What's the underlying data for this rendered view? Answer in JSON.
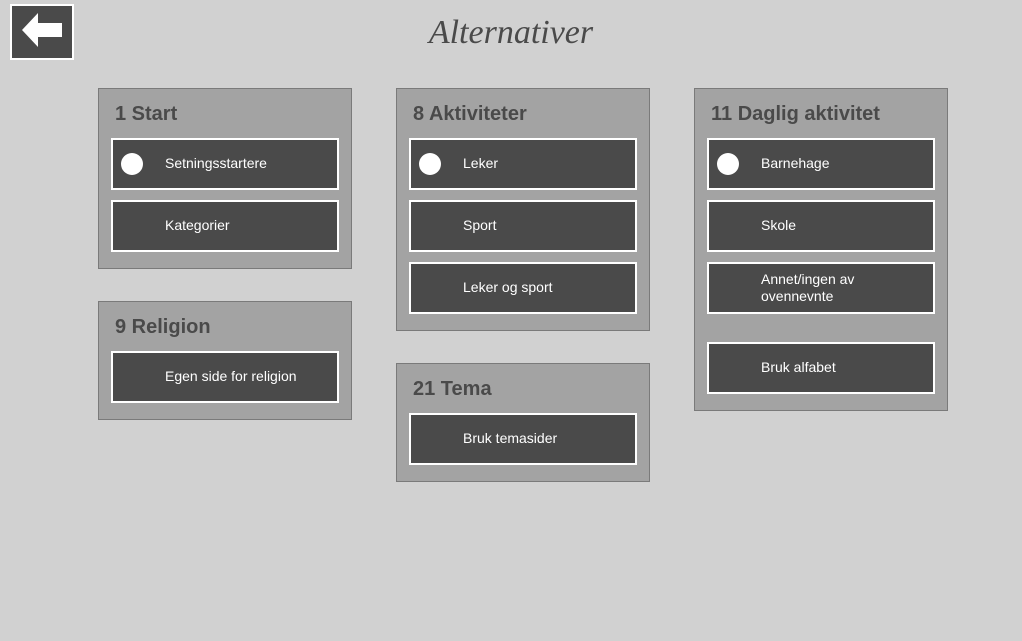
{
  "title": "Alternativer",
  "columns": [
    [
      {
        "id": "start",
        "title": "1 Start",
        "options": [
          {
            "label": "Setningsstartere",
            "selected": true,
            "name": "option-setningsstartere"
          },
          {
            "label": "Kategorier",
            "selected": false,
            "name": "option-kategorier"
          }
        ]
      },
      {
        "id": "religion",
        "title": "9 Religion",
        "options": [
          {
            "label": "Egen side for religion",
            "selected": false,
            "name": "option-egen-side-religion"
          }
        ]
      }
    ],
    [
      {
        "id": "aktiviteter",
        "title": "8 Aktiviteter",
        "options": [
          {
            "label": "Leker",
            "selected": true,
            "name": "option-leker"
          },
          {
            "label": "Sport",
            "selected": false,
            "name": "option-sport"
          },
          {
            "label": "Leker og sport",
            "selected": false,
            "name": "option-leker-og-sport"
          }
        ]
      },
      {
        "id": "tema",
        "title": "21 Tema",
        "options": [
          {
            "label": "Bruk temasider",
            "selected": false,
            "name": "option-bruk-temasider"
          }
        ]
      }
    ],
    [
      {
        "id": "daglig-aktivitet",
        "title": "11 Daglig aktivitet",
        "options": [
          {
            "label": "Barnehage",
            "selected": true,
            "name": "option-barnehage"
          },
          {
            "label": "Skole",
            "selected": false,
            "name": "option-skole"
          },
          {
            "label": "Annet/ingen av ovennevnte",
            "selected": false,
            "name": "option-annet-ingen"
          },
          {
            "label": "Bruk alfabet",
            "selected": false,
            "name": "option-bruk-alfabet",
            "gapBefore": true
          }
        ]
      }
    ]
  ]
}
